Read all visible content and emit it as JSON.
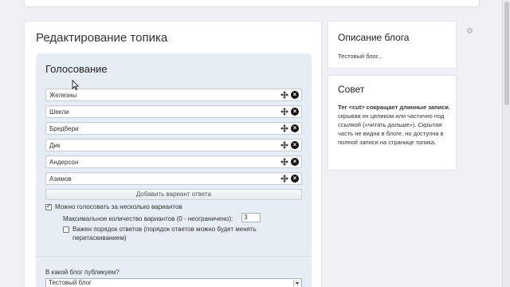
{
  "page": {
    "title": "Редактирование топика"
  },
  "voting": {
    "title": "Голосование",
    "options": [
      "Железны",
      "Шекли",
      "Бредбери",
      "Дик",
      "Андерсон",
      "Азимов"
    ],
    "add_variant_label": "Добавить вариант ответа",
    "multiple_label": "Можно голосовать за несколько вариантов",
    "multiple_checked": true,
    "max_label": "Максимальное количество вариантов (0 - неограничено):",
    "max_value": "3",
    "order_label_line1": "Важен порядок ответов (порядок ответов можно будет менять",
    "order_label_line2": "перетаскиванием)",
    "order_checked": false
  },
  "blog": {
    "label": "В какой блог публикуем?",
    "selected": "Тестовый блог"
  },
  "sidebar": {
    "description_title": "Описание блога",
    "description_text": "Тестовый блог...",
    "tip_title": "Совет",
    "tip_bold": "Тег <cut> сокращает длинные записи",
    "tip_text": ", скрывая их целиком или частично под ссылкой («читать дальше»). Скрытая часть не видна в блоге, но доступна в полной записи на странице топика."
  },
  "icons": {
    "move": "move-icon",
    "remove": "remove-icon",
    "gear": "gear-icon"
  },
  "colors": {
    "voting_bg": "#e6edf4",
    "page_bg": "#eef0f3"
  }
}
